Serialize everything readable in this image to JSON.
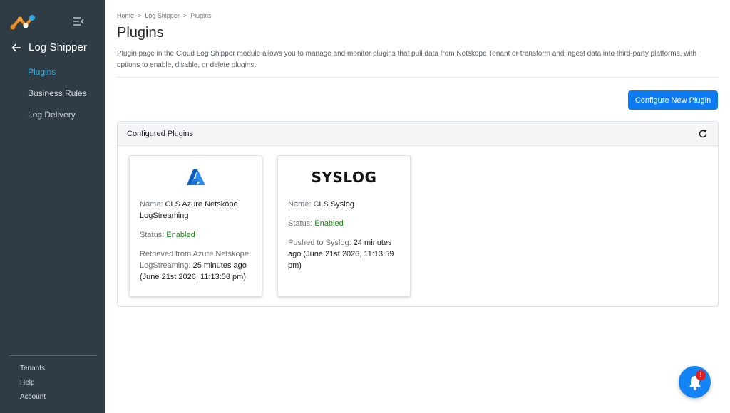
{
  "sidebar": {
    "module_title": "Log Shipper",
    "items": [
      {
        "label": "Plugins",
        "active": true
      },
      {
        "label": "Business Rules",
        "active": false
      },
      {
        "label": "Log Delivery",
        "active": false
      }
    ],
    "bottom_links": [
      "Tenants",
      "Help",
      "Account"
    ]
  },
  "breadcrumb": [
    "Home",
    "Log Shipper",
    "Plugins"
  ],
  "breadcrumb_sep": ">",
  "page": {
    "title": "Plugins",
    "description": "Plugin page in the Cloud Log Shipper module allows you to manage and monitor plugins that pull data from Netskope Tenant or transform and ingest data into third-party platforms, with options to enable, disable, or delete plugins.",
    "configure_button": "Configure New Plugin"
  },
  "panel": {
    "title": "Configured Plugins"
  },
  "plugins": [
    {
      "logo": "azure-logo",
      "name_label": "Name:",
      "name": "CLS Azure Netskope LogStreaming",
      "status_label": "Status:",
      "status": "Enabled",
      "activity_label": "Retrieved from Azure Netskope LogStreaming:",
      "activity": "25 minutes ago (June 21st 2026, 11:13:58 pm)"
    },
    {
      "logo_text": "SYSLOG",
      "name_label": "Name:",
      "name": "CLS Syslog",
      "status_label": "Status:",
      "status": "Enabled",
      "activity_label": "Pushed to Syslog:",
      "activity": "24 minutes ago (June 21st 2026, 11:13:59 pm)"
    }
  ],
  "notifications": {
    "badge": "!"
  },
  "colors": {
    "sidebar_bg": "#2f3b45",
    "active_nav": "#34b7e8",
    "primary": "#0d7cf2",
    "enabled": "#1d8a1d",
    "badge": "#e02020"
  }
}
